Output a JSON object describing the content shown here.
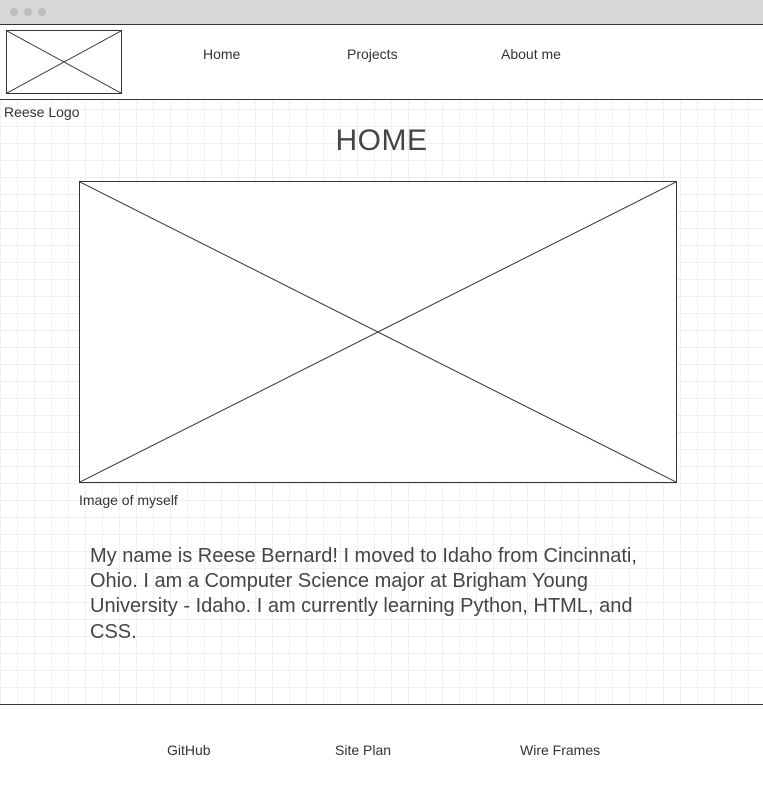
{
  "header": {
    "logo_caption": "Reese Logo",
    "nav": {
      "home": "Home",
      "projects": "Projects",
      "about": "About me"
    }
  },
  "main": {
    "title": "HOME",
    "hero_caption": "Image of myself",
    "bio": "My name is Reese Bernard! I moved to Idaho from Cincinnati, Ohio. I am a Computer Science major at Brigham Young University - Idaho. I am currently learning Python, HTML, and CSS."
  },
  "footer": {
    "github": "GitHub",
    "siteplan": "Site Plan",
    "wireframes": "Wire Frames"
  }
}
